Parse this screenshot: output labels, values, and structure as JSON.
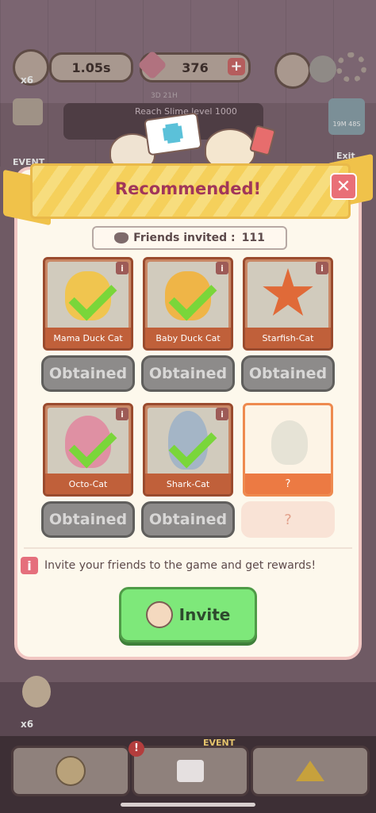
{
  "hud": {
    "timer": "1.05s",
    "gems": "376",
    "multiplier_top": "x6",
    "event_label": "EVENT",
    "quest_timer": "3D 21H",
    "quest_text": "Reach Slime level 1000",
    "side_timer": "19M 48S",
    "exit_label": "Exit",
    "multiplier_bottom": "x6",
    "bottom_event_label": "EVENT"
  },
  "modal": {
    "title": "Recommended!",
    "close_label": "✕",
    "friends_label": "Friends invited :",
    "friends_count": "111",
    "cards": [
      {
        "name": "Mama Duck Cat",
        "button": "Obtained",
        "info": "i",
        "color": "#f3c443"
      },
      {
        "name": "Baby Duck Cat",
        "button": "Obtained",
        "info": "i",
        "color": "#f2b33a"
      },
      {
        "name": "Starfish-Cat",
        "button": "Obtained",
        "info": "i",
        "color": "#e06a38"
      },
      {
        "name": "Octo-Cat",
        "button": "Obtained",
        "info": "i",
        "color": "#e08aa0"
      },
      {
        "name": "Shark-Cat",
        "button": "Obtained",
        "info": "i",
        "color": "#9fb3c7"
      },
      {
        "name": "?",
        "button": "?",
        "info": "",
        "color": "#e6e3d6"
      }
    ],
    "hint": "Invite your friends to the game and get rewards!",
    "hint_icon": "i",
    "invite_label": "Invite"
  }
}
